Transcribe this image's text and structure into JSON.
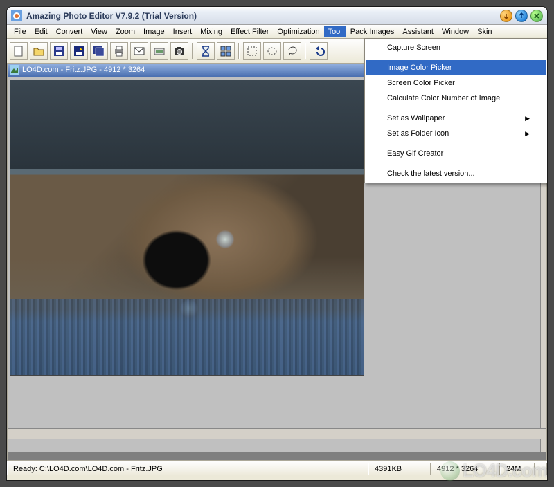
{
  "window": {
    "title": "Amazing Photo Editor V7.9.2 (Trial Version)"
  },
  "menubar": [
    {
      "label": "File",
      "u": 0
    },
    {
      "label": "Edit",
      "u": 0
    },
    {
      "label": "Convert",
      "u": 0
    },
    {
      "label": "View",
      "u": 0
    },
    {
      "label": "Zoom",
      "u": 0
    },
    {
      "label": "Image",
      "u": 0
    },
    {
      "label": "Insert",
      "u": 1
    },
    {
      "label": "Mixing",
      "u": 0
    },
    {
      "label": "Effect Filter",
      "u": 7
    },
    {
      "label": "Optimization",
      "u": 0
    },
    {
      "label": "Tool",
      "u": 0,
      "active": true
    },
    {
      "label": "Pack Images",
      "u": 0
    },
    {
      "label": "Assistant",
      "u": 0
    },
    {
      "label": "Window",
      "u": 0
    },
    {
      "label": "Skin",
      "u": 0
    }
  ],
  "toolbar_icons": [
    "new",
    "open",
    "save",
    "save-as",
    "save-all",
    "print",
    "email",
    "scan",
    "camera",
    "sep",
    "hourglass",
    "tile",
    "sep",
    "select-rect",
    "select-ellipse",
    "select-lasso",
    "sep",
    "undo"
  ],
  "document": {
    "title": "LO4D.com - Fritz.JPG - 4912 * 3264"
  },
  "tool_menu": {
    "items": [
      {
        "label": "Capture Screen"
      },
      {
        "sep": true
      },
      {
        "label": "Image Color Picker",
        "highlight": true
      },
      {
        "label": "Screen Color Picker"
      },
      {
        "label": "Calculate Color Number of Image"
      },
      {
        "sep": true
      },
      {
        "label": "Set as Wallpaper",
        "submenu": true
      },
      {
        "label": "Set as Folder Icon",
        "submenu": true
      },
      {
        "sep": true
      },
      {
        "label": "Easy Gif Creator"
      },
      {
        "sep": true
      },
      {
        "label": "Check the latest version..."
      }
    ]
  },
  "statusbar": {
    "ready": "Ready: C:\\LO4D.com\\LO4D.com - Fritz.JPG",
    "size": "4391KB",
    "dims": "4912 * 3264",
    "bits": "24M"
  },
  "watermark": "LO4D.com"
}
